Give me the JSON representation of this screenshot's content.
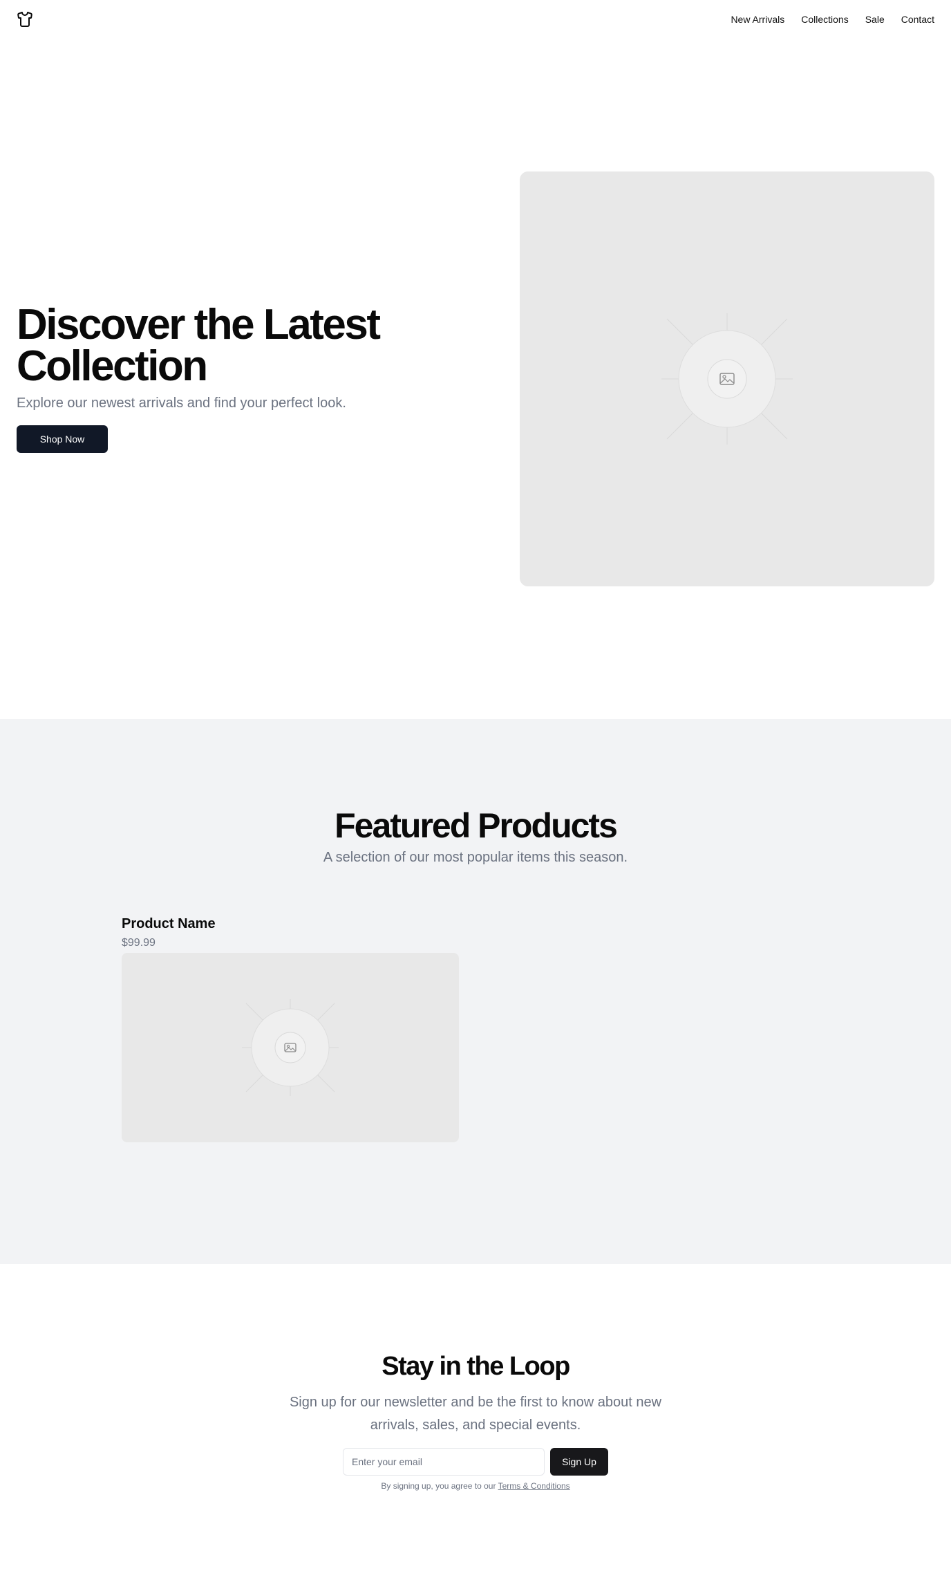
{
  "header": {
    "logo_icon": "tshirt-icon",
    "nav": [
      {
        "label": "New Arrivals"
      },
      {
        "label": "Collections"
      },
      {
        "label": "Sale"
      },
      {
        "label": "Contact"
      }
    ]
  },
  "hero": {
    "title": "Discover the Latest Collection",
    "subtitle": "Explore our newest arrivals and find your perfect look.",
    "cta_label": "Shop Now",
    "image_icon": "image-placeholder-icon"
  },
  "featured": {
    "title": "Featured Products",
    "subtitle": "A selection of our most popular items this season.",
    "products": [
      {
        "name": "Product Name",
        "price": "$99.99",
        "image_icon": "image-placeholder-icon"
      }
    ]
  },
  "newsletter": {
    "title": "Stay in the Loop",
    "subtitle": "Sign up for our newsletter and be the first to know about new arrivals, sales, and special events.",
    "email_placeholder": "Enter your email",
    "button_label": "Sign Up",
    "fineprint_prefix": "By signing up, you agree to our",
    "terms_link": "Terms & Conditions"
  },
  "colors": {
    "primary_button": "#111827",
    "signup_button": "#18181b",
    "muted_text": "#6b7280",
    "section_bg": "#f2f3f5",
    "placeholder_bg": "#e8e8e8"
  }
}
